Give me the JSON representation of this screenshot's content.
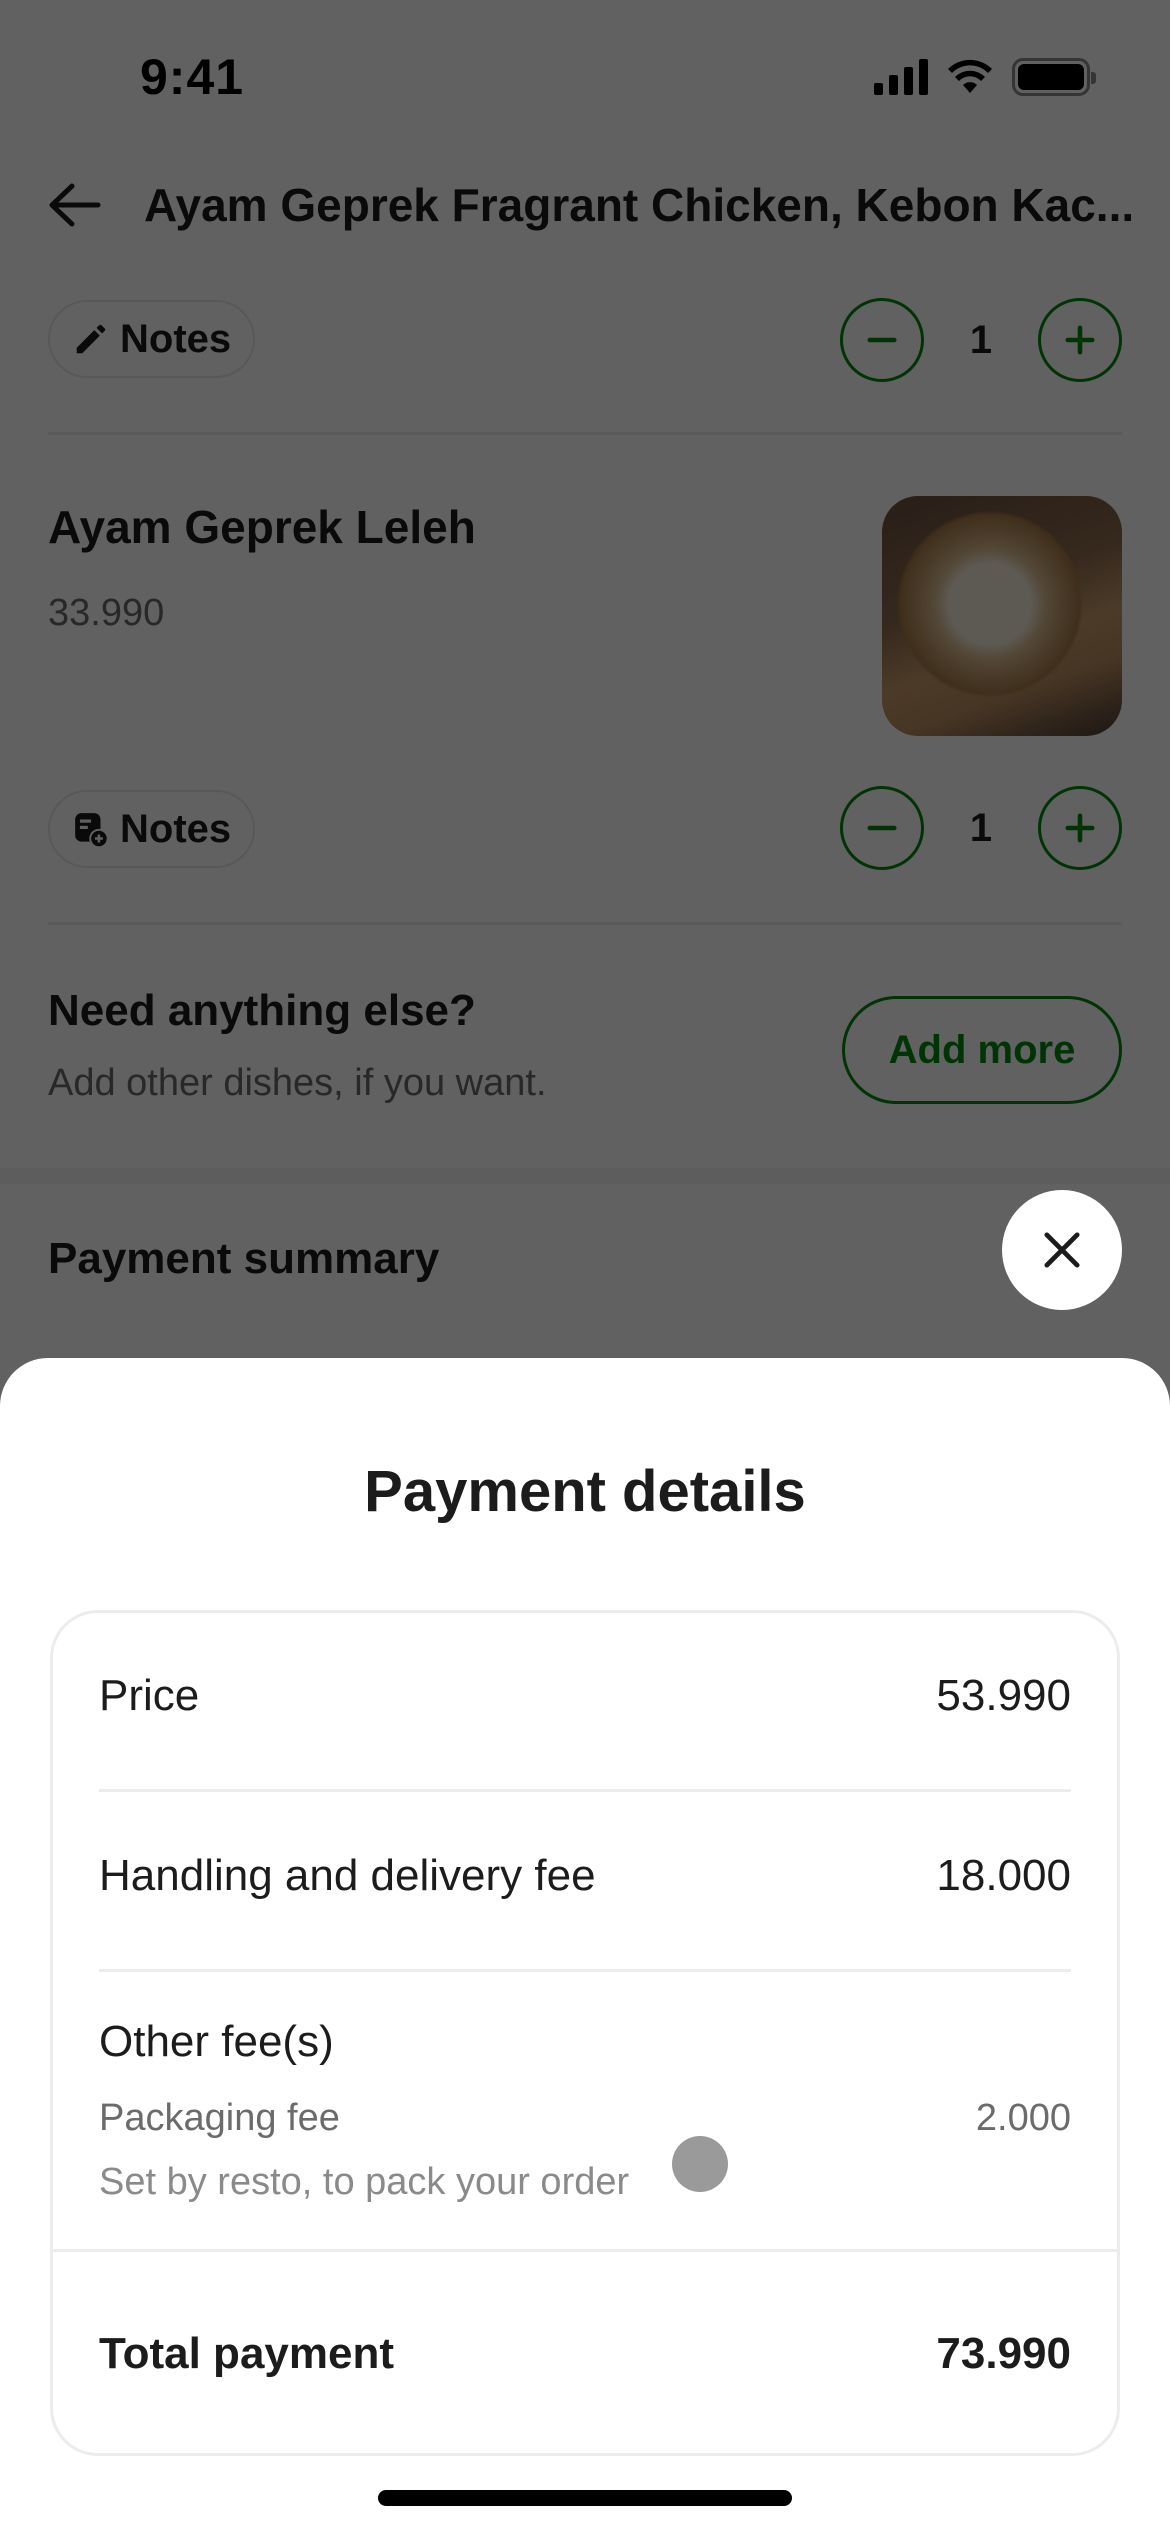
{
  "status_bar": {
    "time": "9:41",
    "icons": [
      "signal-icon",
      "wifi-icon",
      "battery-icon"
    ]
  },
  "header": {
    "back_icon": "arrow-left-icon",
    "title": "Ayam Geprek Fragrant Chicken, Kebon Kac..."
  },
  "cart_items": [
    {
      "notes_label": "Notes",
      "notes_icon": "pencil-icon",
      "quantity": "1"
    },
    {
      "name": "Ayam Geprek Leleh",
      "price": "33.990",
      "image_icon": "food-photo",
      "notes_label": "Notes",
      "notes_icon": "note-add-icon",
      "quantity": "1"
    }
  ],
  "upsell": {
    "title": "Need anything else?",
    "subtitle": "Add other dishes, if you want.",
    "button_label": "Add more"
  },
  "summary": {
    "title": "Payment summary"
  },
  "payment_details": {
    "title": "Payment details",
    "close_icon": "close-icon",
    "price_label": "Price",
    "price_value": "53.990",
    "delivery_label": "Handling and delivery fee",
    "delivery_value": "18.000",
    "other_fees_label": "Other fee(s)",
    "packaging_label": "Packaging fee",
    "packaging_value": "2.000",
    "packaging_note": "Set by resto, to pack your order",
    "total_label": "Total payment",
    "total_value": "73.990"
  },
  "colors": {
    "accent_green": "#00880d",
    "scrim": "rgba(0,0,0,0.62)"
  }
}
